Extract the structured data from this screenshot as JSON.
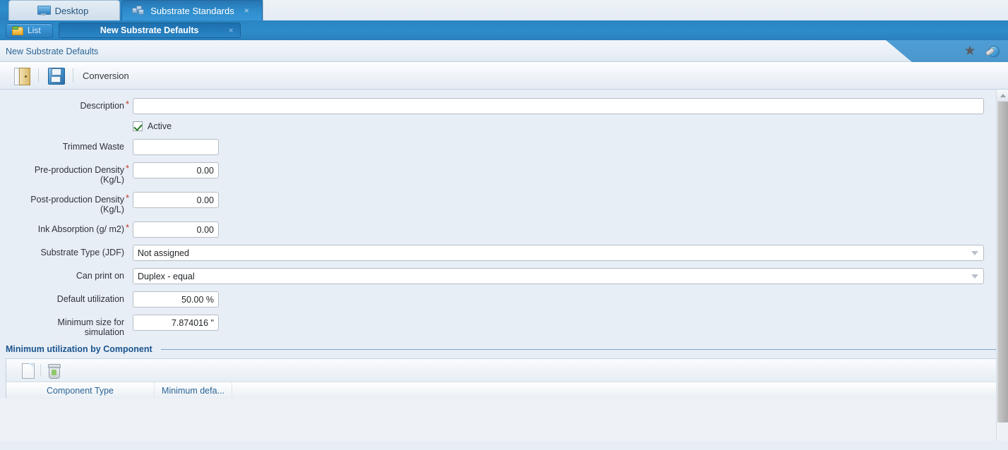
{
  "app_tabs": [
    {
      "label": "Desktop",
      "icon": "monitor-icon",
      "active": false,
      "closable": false
    },
    {
      "label": "Substrate Standards",
      "icon": "stack-icon",
      "active": true,
      "closable": true,
      "close_label": "×"
    }
  ],
  "subbar": {
    "list_button": {
      "label": "List",
      "icon": "folder-icon"
    },
    "record_tab": {
      "label": "New Substrate Defaults",
      "close_label": "×"
    }
  },
  "breadcrumb": {
    "title": "New Substrate Defaults",
    "icons": [
      {
        "name": "favorite-star-icon",
        "glyph": "★"
      },
      {
        "name": "help-globe-icon",
        "glyph": ""
      }
    ]
  },
  "toolbar": {
    "close_label": "",
    "save_label": "",
    "conversion_label": "Conversion"
  },
  "form": {
    "fields": [
      {
        "key": "description",
        "label": "Description",
        "required": true,
        "type": "text",
        "value": "",
        "width": "wide"
      },
      {
        "key": "trimmed_waste",
        "label": "Trimmed Waste",
        "required": false,
        "type": "text",
        "value": "",
        "width": "small"
      },
      {
        "key": "pre_density",
        "label": "Pre-production Density (Kg/L)",
        "required": true,
        "type": "number",
        "value": "0.00"
      },
      {
        "key": "post_density",
        "label": "Post-production Density (Kg/L)",
        "required": true,
        "type": "number",
        "value": "0.00"
      },
      {
        "key": "ink_absorb",
        "label": "Ink Absorption (g/ m2)",
        "required": true,
        "type": "number",
        "value": "0.00"
      },
      {
        "key": "substrate_type",
        "label": "Substrate Type (JDF)",
        "required": false,
        "type": "select",
        "value": "Not assigned"
      },
      {
        "key": "can_print_on",
        "label": "Can print on",
        "required": false,
        "type": "select",
        "value": "Duplex - equal"
      },
      {
        "key": "default_util",
        "label": "Default utilization",
        "required": false,
        "type": "number",
        "value": "50.00 %"
      },
      {
        "key": "min_size",
        "label": "Minimum size for simulation",
        "required": false,
        "type": "number",
        "value": "7.874016 \""
      }
    ],
    "labels": {
      "description": "Description",
      "trimmed_waste": "Trimmed Waste",
      "pre_density_l1": "Pre-production Density",
      "pre_density_l2": "(Kg/L)",
      "post_density_l1": "Post-production Density",
      "post_density_l2": "(Kg/L)",
      "ink_absorption": "Ink Absorption (g/ m2)",
      "substrate_type": "Substrate Type (JDF)",
      "can_print_on": "Can print on",
      "default_utilization": "Default utilization",
      "min_size_l1": "Minimum size for",
      "min_size_l2": "simulation"
    },
    "values": {
      "description": "",
      "trimmed_waste": "",
      "pre_density": "0.00",
      "post_density": "0.00",
      "ink_absorption": "0.00",
      "substrate_type": "Not assigned",
      "can_print_on": "Duplex - equal",
      "default_utilization": "50.00 %",
      "min_size": "7.874016 \""
    },
    "active_checkbox": {
      "label": "Active",
      "checked": true
    },
    "required_marker": "*"
  },
  "section": {
    "title": "Minimum utilization by Component"
  },
  "grid": {
    "toolbar": [
      {
        "name": "new-row-icon",
        "label": ""
      },
      {
        "name": "delete-row-icon",
        "label": ""
      }
    ],
    "columns": [
      "Component Type",
      "Minimum defa..."
    ],
    "rows": []
  },
  "scrollbar": {
    "up_arrow": "▲"
  },
  "colors": {
    "header_blue": "#2e8ccb",
    "active_tab_blue": "#1d6fae",
    "link_blue": "#2a6496",
    "section_title_blue": "#1a5490",
    "required_red": "#c0392b",
    "check_green": "#1f7a1f",
    "form_bg": "#e8eef5"
  }
}
